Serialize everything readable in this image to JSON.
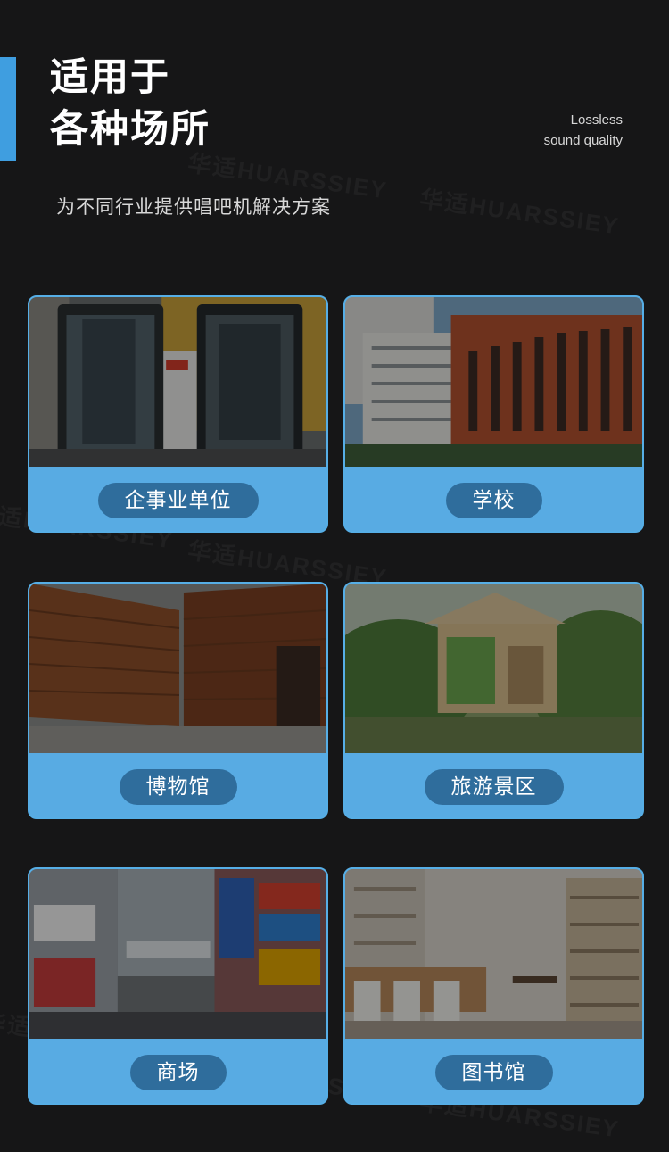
{
  "header": {
    "title_line1": "适用于",
    "title_line2": "各种场所",
    "tagline_line1": "Lossless",
    "tagline_line2": "sound quality",
    "subtitle": "为不同行业提供唱吧机解决方案"
  },
  "watermark_text": "华适HUARSSIEY",
  "colors": {
    "background": "#161617",
    "accent": "#3f9ee0",
    "card_fill": "#58abe3",
    "label_pill": "#2f6d9c"
  },
  "venues": [
    {
      "label": "企事业单位",
      "scene": "karaoke-booths-photo"
    },
    {
      "label": "学校",
      "scene": "school-building-photo"
    },
    {
      "label": "博物馆",
      "scene": "museum-building-photo"
    },
    {
      "label": "旅游景区",
      "scene": "scenic-area-photo"
    },
    {
      "label": "商场",
      "scene": "shopping-street-photo"
    },
    {
      "label": "图书馆",
      "scene": "library-interior-photo"
    }
  ]
}
